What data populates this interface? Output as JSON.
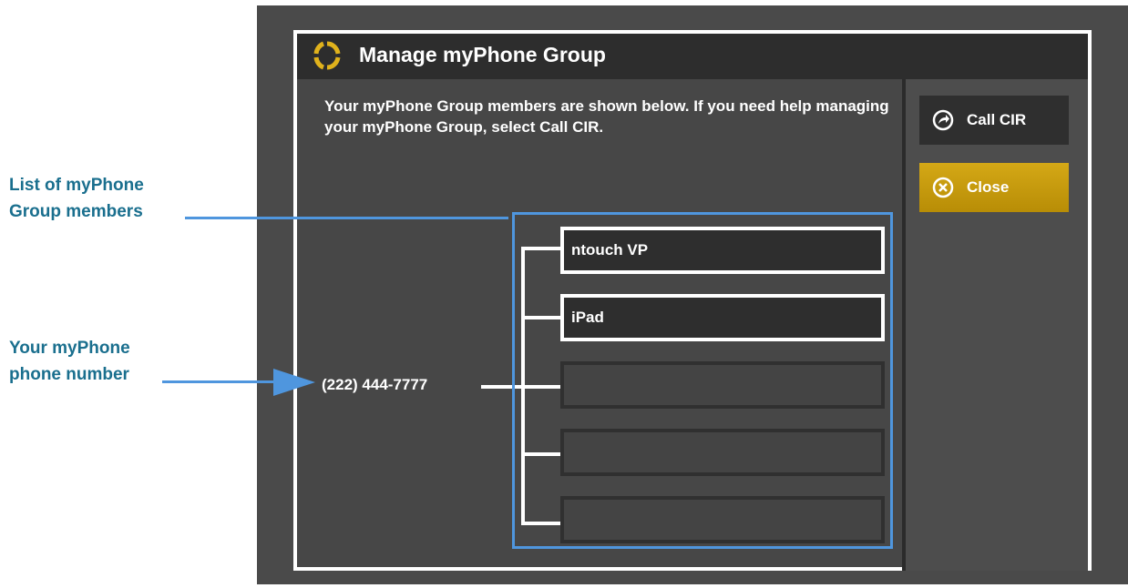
{
  "dialog": {
    "title": "Manage myPhone Group",
    "title_icon": "myphone-ring-icon",
    "message": "Your myPhone Group members are shown below.  If you need help managing your myPhone Group, select Call CIR."
  },
  "buttons": {
    "call_cir": {
      "label": "Call CIR",
      "icon": "call-arrow-icon"
    },
    "close": {
      "label": "Close",
      "icon": "close-circle-icon"
    }
  },
  "phone_number": "(222) 444-7777",
  "members": [
    {
      "label": "ntouch VP",
      "filled": true
    },
    {
      "label": "iPad",
      "filled": true
    },
    {
      "label": "",
      "filled": false
    },
    {
      "label": "",
      "filled": false
    },
    {
      "label": "",
      "filled": false
    }
  ],
  "callouts": {
    "list_line1": "List of myPhone",
    "list_line2": "Group members",
    "phone_line1": "Your myPhone",
    "phone_line2": "phone number"
  },
  "colors": {
    "accent_gold": "#d4a816",
    "highlight_blue": "#4f96de",
    "callout_text": "#1a6f8e",
    "screen_bg": "#4a4a4a"
  }
}
